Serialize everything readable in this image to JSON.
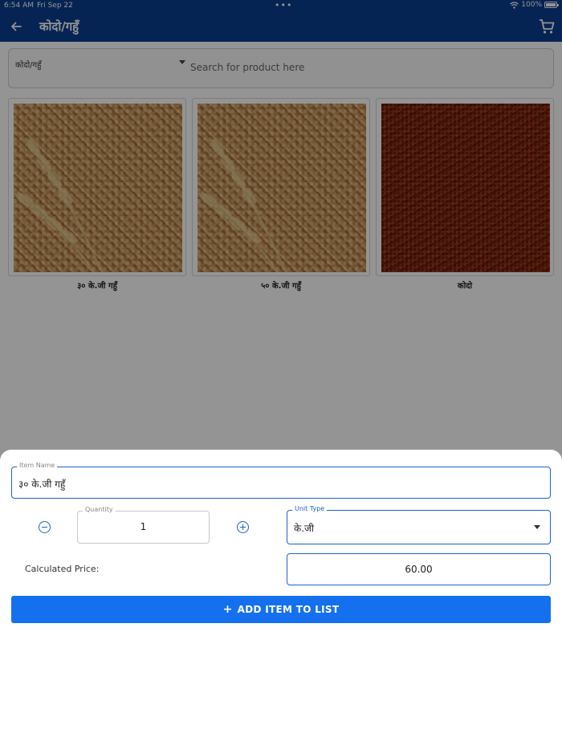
{
  "status_bar": {
    "time": "6:54 AM",
    "date": "Fri Sep 22",
    "battery": "100%"
  },
  "app_bar": {
    "title": "कोदो/गहुँ"
  },
  "filter": {
    "category": "कोदो/गहुँ",
    "search_placeholder": "Search for product here"
  },
  "products": [
    {
      "label": "३० के.जी गहुँ",
      "image": "wheat"
    },
    {
      "label": "५० के.जी गहुँ",
      "image": "wheat"
    },
    {
      "label": "कोदो",
      "image": "millet"
    }
  ],
  "sheet": {
    "item_name_label": "Item Name",
    "item_name_value": "३० के.जी गहुँ",
    "quantity_label": "Quantity",
    "quantity_value": "1",
    "unit_type_label": "Unit Type",
    "unit_type_value": "के.जी",
    "price_label": "Calculated Price:",
    "price_value": "60.00",
    "add_button_label": "ADD ITEM TO LIST"
  },
  "colors": {
    "primary": "#0a3f8f",
    "accent": "#1570ef",
    "field_active": "#1a63c7"
  }
}
